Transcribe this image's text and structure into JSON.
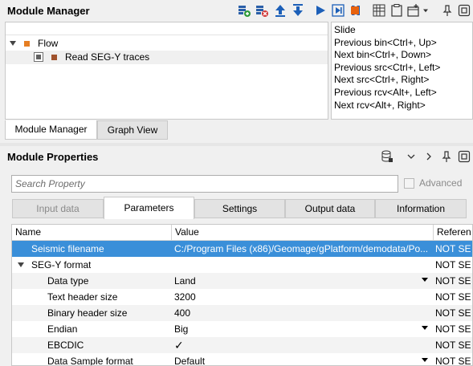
{
  "module_manager": {
    "title": "Module Manager",
    "toolbar_icons": [
      "add-module-icon",
      "remove-module-icon",
      "move-up-icon",
      "move-down-icon",
      "run-icon",
      "run-step-icon",
      "pause-icon",
      "stop-icon",
      "grid-icon",
      "clipboard-icon",
      "new-window-icon",
      "menu-dropdown-icon",
      "pin-icon",
      "float-icon"
    ],
    "tree": {
      "root_label": "Flow",
      "child_label": "Read SEG-Y traces"
    },
    "shortcuts": [
      "Slide",
      "Previous bin<Ctrl+, Up>",
      "Next bin<Ctrl+, Down>",
      "Previous src<Ctrl+, Left>",
      "Next src<Ctrl+, Right>",
      "Previous rcv<Alt+, Left>",
      "Next rcv<Alt+, Right>"
    ],
    "tabs": [
      "Module Manager",
      "Graph View"
    ]
  },
  "module_properties": {
    "title": "Module Properties",
    "toolbar_icons": [
      "database-icon",
      "chevron-down-icon",
      "chevron-right-icon",
      "pin-icon",
      "float-icon"
    ],
    "search_placeholder": "Search Property",
    "advanced_label": "Advanced",
    "tabs": [
      "Input data",
      "Parameters",
      "Settings",
      "Output data",
      "Information"
    ],
    "active_tab": "Parameters",
    "columns": [
      "Name",
      "Value",
      "Referen"
    ],
    "rows": [
      {
        "name": "Seismic filename",
        "value": "C:/Program Files (x86)/Geomage/gPlatform/demodata/Po...",
        "ref": "NOT SE"
      },
      {
        "name": "SEG-Y format",
        "value": "",
        "ref": "NOT SE"
      },
      {
        "name": "Data type",
        "value": "Land",
        "ref": "NOT SE"
      },
      {
        "name": "Text header size",
        "value": "3200",
        "ref": "NOT SE"
      },
      {
        "name": "Binary header size",
        "value": "400",
        "ref": "NOT SE"
      },
      {
        "name": "Endian",
        "value": "Big",
        "ref": "NOT SE"
      },
      {
        "name": "EBCDIC",
        "value": "✓",
        "ref": "NOT SE"
      },
      {
        "name": "Data Sample format",
        "value": "Default",
        "ref": "NOT SE"
      }
    ]
  },
  "colors": {
    "selection": "#3a8fd9",
    "flow_square": "#e67e22",
    "module_square": "#a0522d",
    "toolbar_blue": "#1c5fb8",
    "stop_orange": "#e8620e"
  }
}
